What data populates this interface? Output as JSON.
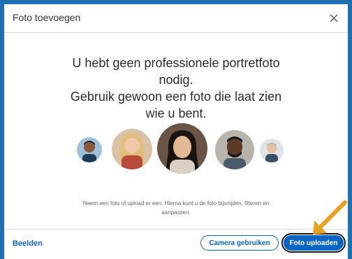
{
  "dialog": {
    "title": "Foto toevoegen",
    "close_label": "×",
    "headline_line1": "U hebt geen professionele portretfoto",
    "headline_line2": "nodig.",
    "headline_line3": "Gebruik gewoon een foto die laat zien",
    "headline_line4": "wie u bent.",
    "hint_line1": "Neem een foto of upload er een. Hierna kunt u de foto bijsnijden, filteren en",
    "hint_line2": "aanpassen."
  },
  "footer": {
    "link": "Beelden",
    "secondary_button": "Camera gebruiken",
    "primary_button": "Foto uploaden"
  },
  "colors": {
    "accent": "#0a66c2",
    "backdrop": "#1f6fb2",
    "arrow": "#e8a020"
  },
  "icons": {
    "close": "close-icon",
    "arrow": "pointer-arrow"
  }
}
